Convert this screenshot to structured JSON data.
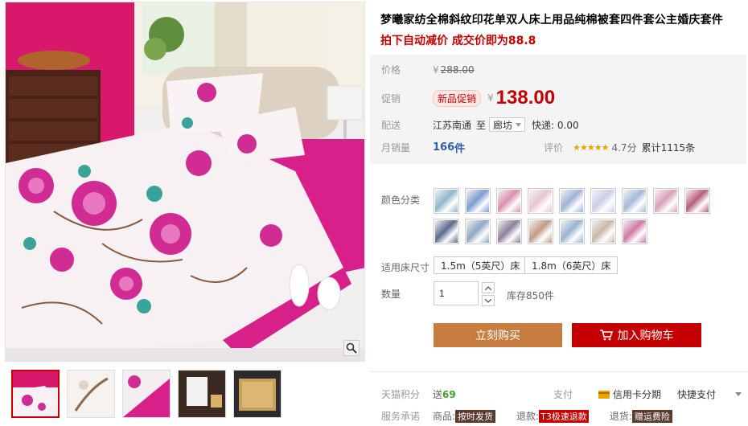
{
  "product": {
    "title": "梦曦家纺全棉斜纹印花单双人床上用品纯棉被套四件套公主婚庆套件",
    "subtitle": "拍下自动减价 成交价即为88.8"
  },
  "price": {
    "label": "价格",
    "original_currency": "¥",
    "original": "288.00",
    "promo_label": "促销",
    "promo_tag": "新品促销",
    "currency": "¥",
    "current": "138.00"
  },
  "shipping": {
    "label": "配送",
    "from": "江苏南通",
    "to_word": "至",
    "destination": "廊坊",
    "fee": "快递: 0.00"
  },
  "sales": {
    "label": "月销量",
    "count": "166",
    "unit": "件",
    "rating_label": "评价",
    "stars": "★★★★★",
    "score": "4.7分",
    "reviews": "累计1115条"
  },
  "colors": {
    "label": "颜色分类",
    "swatches": [
      "#8fb7c9",
      "#7f9bd1",
      "#d98fb0",
      "#e9c6cf",
      "#9fb3d6",
      "#c9cfe6",
      "#a9b9d9",
      "#d9a0b8",
      "#b8607a",
      "#5d6a8c",
      "#8fa6c4",
      "#8f7f9a",
      "#c49a86",
      "#9ab2d0",
      "#c8b8a8",
      "#d07aa8"
    ]
  },
  "size": {
    "label": "适用床尺寸",
    "options": [
      "1.5m（5英尺）床",
      "1.8m（6英尺）床"
    ]
  },
  "quantity": {
    "label": "数量",
    "value": "1",
    "stock": "库存850件"
  },
  "actions": {
    "buy_now": "立刻购买",
    "add_cart": "加入购物车"
  },
  "footer": {
    "points_label": "天猫积分",
    "points_prefix": "送",
    "points_value": "69",
    "pay_label": "支付",
    "credit_card": "信用卡分期",
    "quick_pay": "快捷支付",
    "promise_label": "服务承诺",
    "goods_label": "商品:",
    "goods_tag": "按时发货",
    "refund_label": "退款:",
    "refund_tag": "T3极速退款",
    "return_label": "退货:",
    "return_tag": "赠运费险"
  },
  "icons": {
    "zoom": "magnifier-icon",
    "cart": "cart-icon",
    "card": "credit-card-icon"
  }
}
